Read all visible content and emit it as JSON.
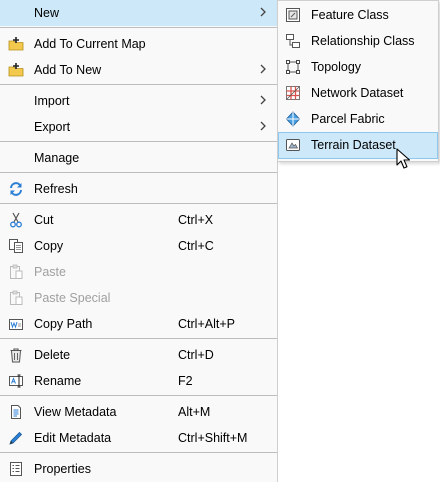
{
  "menu": {
    "new": {
      "label": "New"
    },
    "add_to_current_map": {
      "label": "Add To Current Map"
    },
    "add_to_new": {
      "label": "Add To New"
    },
    "import": {
      "label": "Import"
    },
    "export": {
      "label": "Export"
    },
    "manage": {
      "label": "Manage"
    },
    "refresh": {
      "label": "Refresh"
    },
    "cut": {
      "label": "Cut",
      "shortcut": "Ctrl+X"
    },
    "copy": {
      "label": "Copy",
      "shortcut": "Ctrl+C"
    },
    "paste": {
      "label": "Paste",
      "disabled": true
    },
    "paste_special": {
      "label": "Paste Special",
      "disabled": true
    },
    "copy_path": {
      "label": "Copy Path",
      "shortcut": "Ctrl+Alt+P"
    },
    "delete": {
      "label": "Delete",
      "shortcut": "Ctrl+D"
    },
    "rename": {
      "label": "Rename",
      "shortcut": "F2"
    },
    "view_metadata": {
      "label": "View Metadata",
      "shortcut": "Alt+M"
    },
    "edit_metadata": {
      "label": "Edit Metadata",
      "shortcut": "Ctrl+Shift+M"
    },
    "properties": {
      "label": "Properties"
    }
  },
  "submenu": {
    "feature_class": {
      "label": "Feature Class"
    },
    "relationship_class": {
      "label": "Relationship Class"
    },
    "topology": {
      "label": "Topology"
    },
    "network_dataset": {
      "label": "Network Dataset"
    },
    "parcel_fabric": {
      "label": "Parcel Fabric"
    },
    "terrain_dataset": {
      "label": "Terrain Dataset",
      "highlighted": true
    }
  },
  "colors": {
    "highlight": "#cde8f8",
    "menu_background": "#f9f9f9",
    "disabled_text": "#a0a0a0",
    "accent_blue": "#2b7fd4"
  }
}
